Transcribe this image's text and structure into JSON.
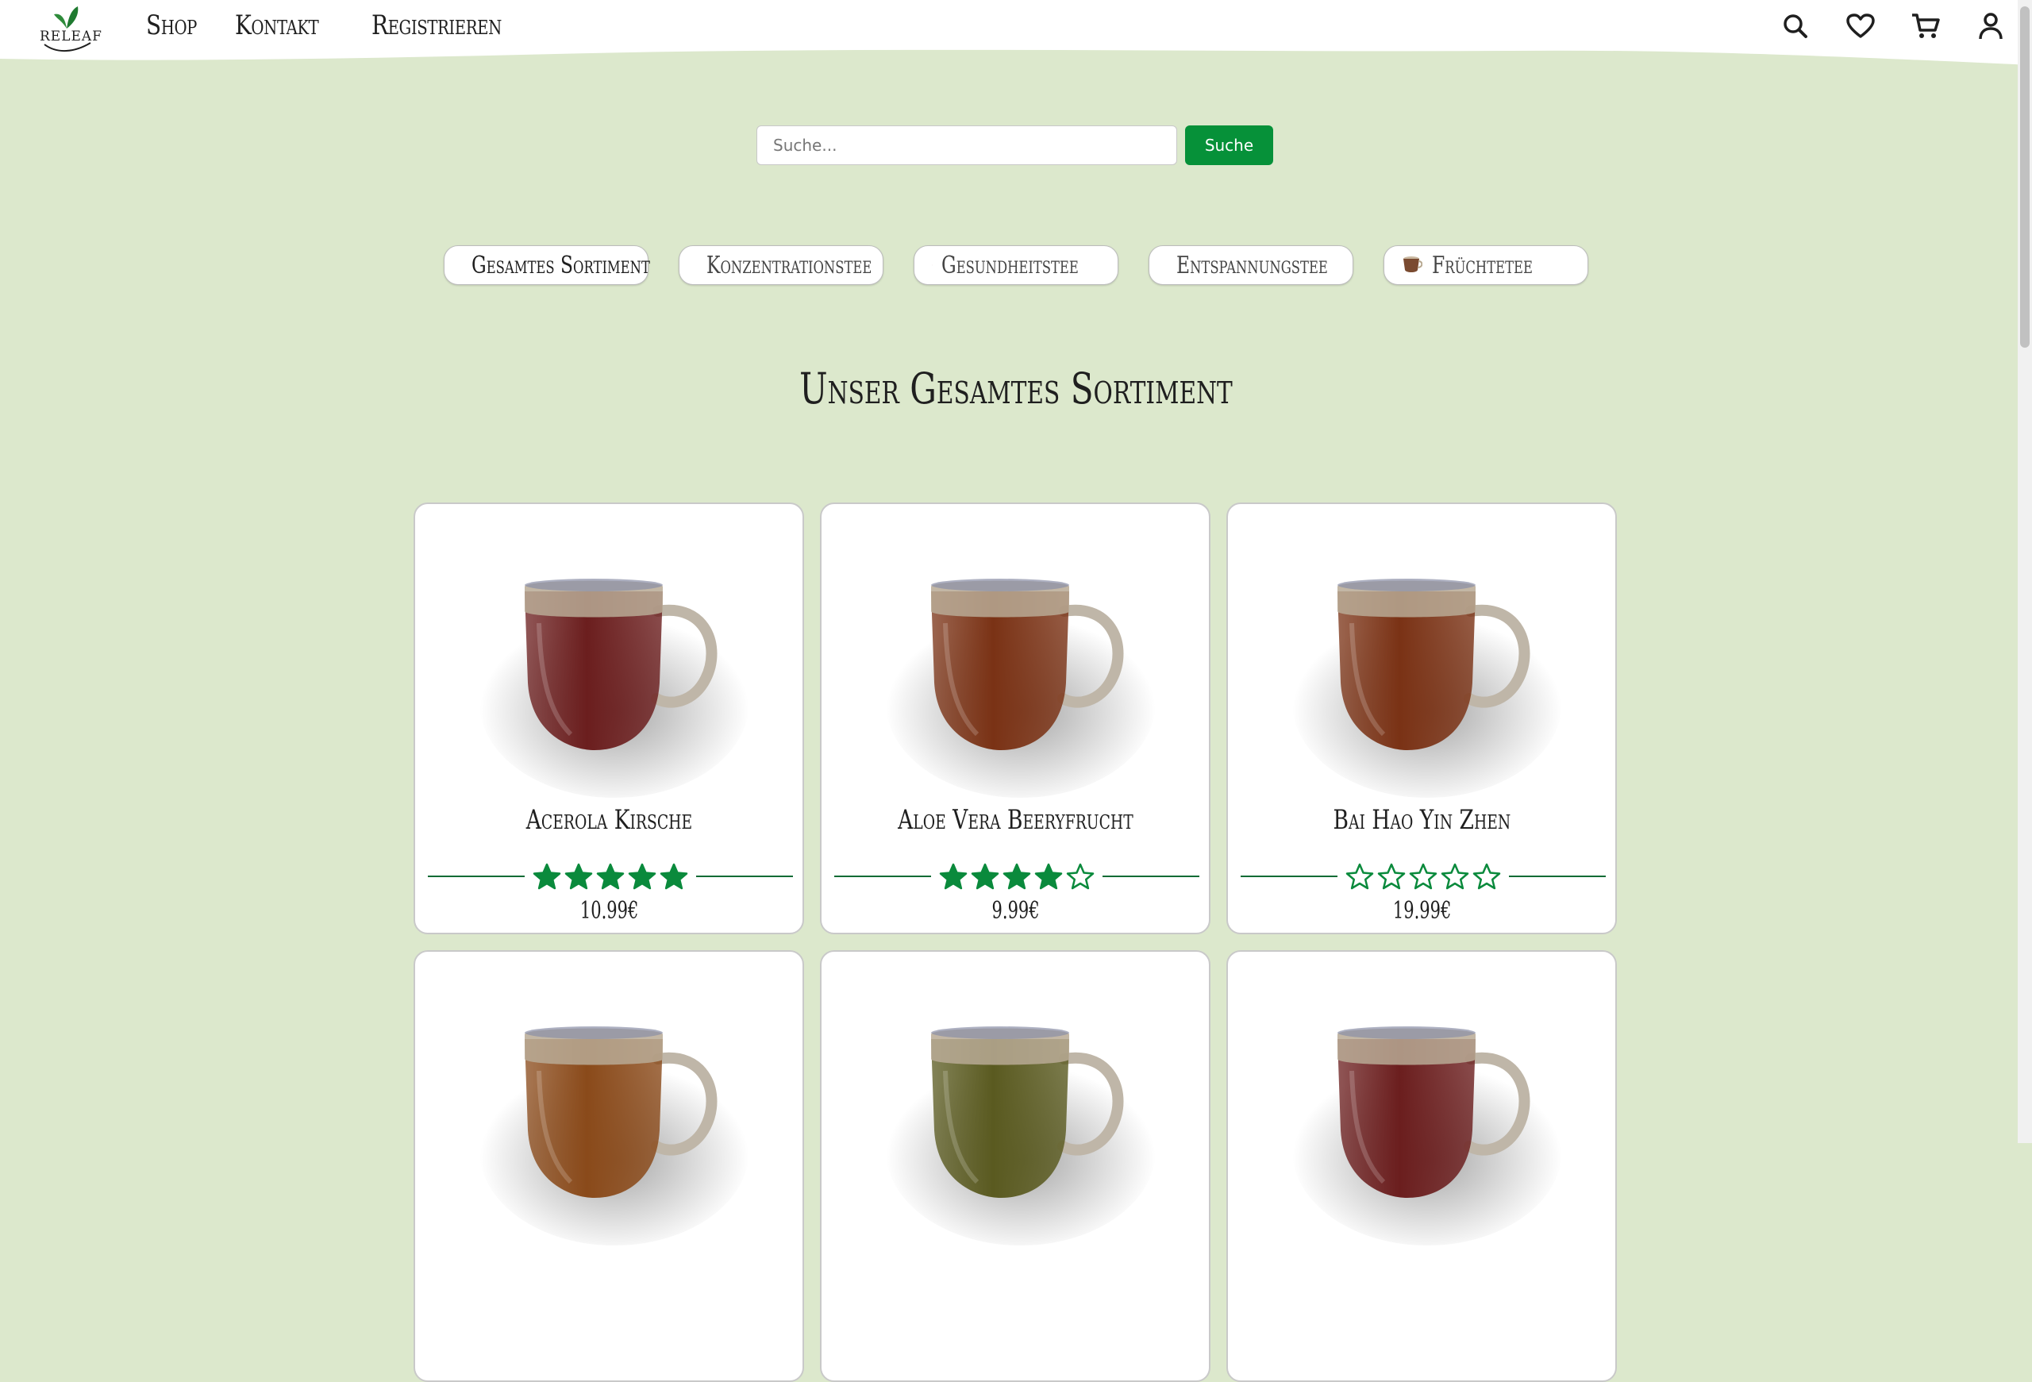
{
  "logo": {
    "text": "RELEAF"
  },
  "nav": {
    "items": [
      "Shop",
      "Kontakt",
      "Registrieren"
    ]
  },
  "header_icons": [
    "search-icon",
    "heart-icon",
    "cart-icon",
    "user-icon"
  ],
  "search": {
    "placeholder": "Suche...",
    "value": "",
    "button_label": "Suche"
  },
  "categories": [
    {
      "label": "Gesamtes Sortiment",
      "cup_color": "#5a1c1c",
      "active": true
    },
    {
      "label": "Konzentrationstee",
      "cup_color": "#5d6b3a",
      "active": false
    },
    {
      "label": "Gesundheitstee",
      "cup_color": "#7a3a2a",
      "active": false
    },
    {
      "label": "Entspannungstee",
      "cup_color": "#6e2620",
      "active": false
    },
    {
      "label": "Früchtetee",
      "cup_color": "#7a4a30",
      "active": false
    }
  ],
  "page_title": "Unser Gesamtes Sortiment",
  "products": [
    {
      "name": "Acerola Kirsche",
      "rating": 5,
      "price": "10.99€",
      "tea_color": "#6b1e1e"
    },
    {
      "name": "Aloe Vera Beeryfrucht",
      "rating": 4,
      "price": "9.99€",
      "tea_color": "#7a3215"
    },
    {
      "name": "Bai Hao Yin Zhen",
      "rating": 0,
      "price": "19.99€",
      "tea_color": "#7a3215"
    },
    {
      "name": "",
      "rating": null,
      "price": "",
      "tea_color": "#8a4a1a"
    },
    {
      "name": "",
      "rating": null,
      "price": "",
      "tea_color": "#5a5a20"
    },
    {
      "name": "",
      "rating": null,
      "price": "",
      "tea_color": "#6b1e1e"
    }
  ],
  "colors": {
    "background": "#dce8cc",
    "accent": "#069139",
    "star": "#0a8a3c"
  }
}
